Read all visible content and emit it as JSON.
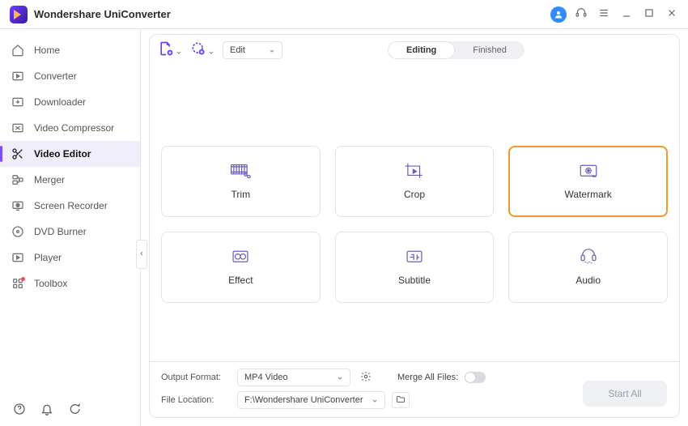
{
  "app": {
    "title": "Wondershare UniConverter"
  },
  "sidebar": {
    "items": [
      {
        "label": "Home"
      },
      {
        "label": "Converter"
      },
      {
        "label": "Downloader"
      },
      {
        "label": "Video Compressor"
      },
      {
        "label": "Video Editor"
      },
      {
        "label": "Merger"
      },
      {
        "label": "Screen Recorder"
      },
      {
        "label": "DVD Burner"
      },
      {
        "label": "Player"
      },
      {
        "label": "Toolbox"
      }
    ],
    "active_index": 4,
    "dot_index": 9
  },
  "toolbar": {
    "edit_dropdown": "Edit",
    "tabs": {
      "editing": "Editing",
      "finished": "Finished",
      "active": "editing"
    }
  },
  "tools": [
    {
      "label": "Trim"
    },
    {
      "label": "Crop"
    },
    {
      "label": "Watermark"
    },
    {
      "label": "Effect"
    },
    {
      "label": "Subtitle"
    },
    {
      "label": "Audio"
    }
  ],
  "tools_selected_index": 2,
  "footer": {
    "output_format_label": "Output Format:",
    "output_format_value": "MP4 Video",
    "file_location_label": "File Location:",
    "file_location_value": "F:\\Wondershare UniConverter",
    "merge_label": "Merge All Files:",
    "merge_on": false,
    "start_label": "Start All"
  }
}
